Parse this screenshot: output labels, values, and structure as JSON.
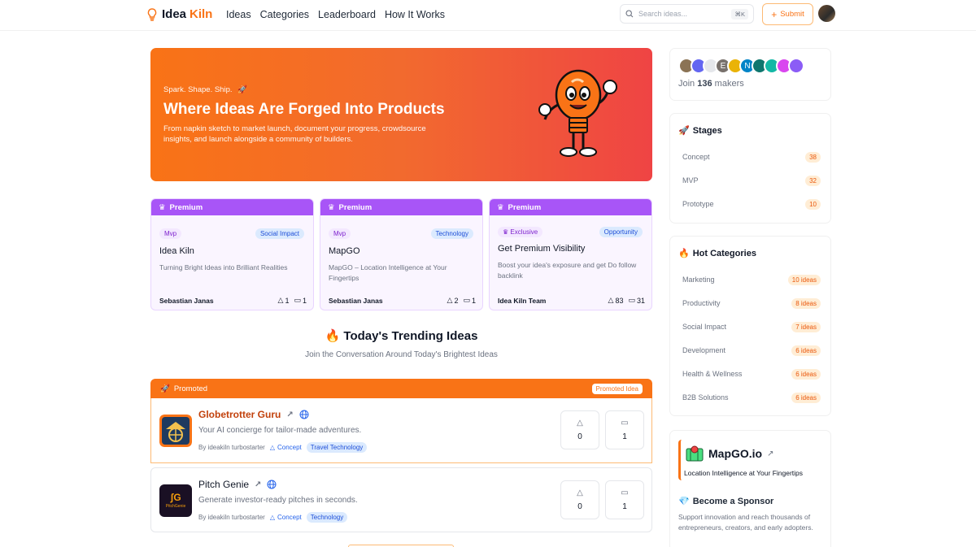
{
  "brand": {
    "word1": "Idea",
    "word2": "Kiln"
  },
  "nav": [
    "Ideas",
    "Categories",
    "Leaderboard",
    "How It Works"
  ],
  "search": {
    "placeholder": "Search ideas...",
    "shortcut": "⌘K"
  },
  "submit_label": "Submit",
  "hero": {
    "tagline": "Spark. Shape. Ship.",
    "title": "Where Ideas Are Forged Into Products",
    "description": "From napkin sketch to market launch, document your progress, crowdsource insights, and launch alongside a community of builders."
  },
  "premium_cards": [
    {
      "header": "Premium",
      "stage": "Mvp",
      "category": "Social Impact",
      "title": "Idea Kiln",
      "description": "Turning Bright Ideas into Brilliant Realities",
      "author": "Sebastian Janas",
      "upvotes": "1",
      "comments": "1"
    },
    {
      "header": "Premium",
      "stage": "Mvp",
      "category": "Technology",
      "title": "MapGO",
      "description": "MapGO – Location Intelligence at Your Fingertips",
      "author": "Sebastian Janas",
      "upvotes": "2",
      "comments": "1"
    },
    {
      "header": "Premium",
      "stage": "Exclusive",
      "category": "Opportunity",
      "title": "Get Premium Visibility",
      "description": "Boost your idea's exposure and get Do follow backlink",
      "author": "Idea Kiln Team",
      "upvotes": "83",
      "comments": "31"
    }
  ],
  "trending": {
    "title": "Today's Trending Ideas",
    "subtitle": "Join the Conversation Around Today's Brightest Ideas"
  },
  "promoted": {
    "label": "Promoted",
    "badge": "Promoted Idea"
  },
  "ideas": [
    {
      "title": "Globetrotter Guru",
      "description": "Your AI concierge for tailor-made adventures.",
      "by": "By ideakiln turbostarter",
      "stage": "Concept",
      "category": "Travel Technology",
      "upvotes": "0",
      "comments": "1"
    },
    {
      "title": "Pitch Genie",
      "description": "Generate investor-ready pitches in seconds.",
      "by": "By ideakiln turbostarter",
      "stage": "Concept",
      "category": "Technology",
      "upvotes": "0",
      "comments": "1",
      "logo_text": "PitchGenie"
    }
  ],
  "makers": {
    "join_prefix": "Join",
    "count": "136",
    "join_suffix": "makers",
    "letters": [
      "E",
      "N"
    ]
  },
  "stages": {
    "title": "Stages",
    "items": [
      {
        "label": "Concept",
        "count": "38"
      },
      {
        "label": "MVP",
        "count": "32"
      },
      {
        "label": "Prototype",
        "count": "10"
      }
    ]
  },
  "hot_categories": {
    "title": "Hot Categories",
    "items": [
      {
        "label": "Marketing",
        "count": "10 ideas"
      },
      {
        "label": "Productivity",
        "count": "8 ideas"
      },
      {
        "label": "Social Impact",
        "count": "7 ideas"
      },
      {
        "label": "Development",
        "count": "6 ideas"
      },
      {
        "label": "Health & Wellness",
        "count": "6 ideas"
      },
      {
        "label": "B2B Solutions",
        "count": "6 ideas"
      }
    ]
  },
  "sponsor": {
    "name": "MapGO.io",
    "tagline": "Location Intelligence at Your Fingertips",
    "become_title": "Become a Sponsor",
    "become_desc": "Support innovation and reach thousands of entrepreneurs, creators, and early adopters."
  },
  "colors": {
    "accent": "#f97316",
    "premium": "#a855f7",
    "hero_end": "#ef4444"
  }
}
